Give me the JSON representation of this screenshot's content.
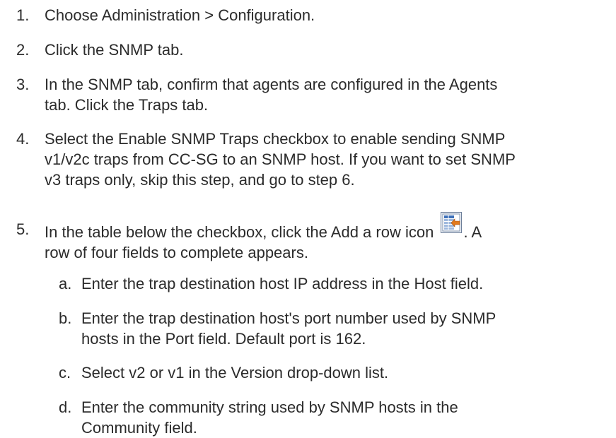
{
  "steps": [
    {
      "num": "1.",
      "text": "Choose Administration > Configuration."
    },
    {
      "num": "2.",
      "text": "Click the SNMP tab."
    },
    {
      "num": "3.",
      "line1": "In the SNMP tab, confirm that agents are configured in the Agents",
      "line2": "tab. Click the Traps tab."
    },
    {
      "num": "4.",
      "line1": "Select the Enable SNMP Traps checkbox to enable sending SNMP",
      "line2": "v1/v2c traps from CC-SG to an SNMP host. If you want to set SNMP",
      "line3": "v3 traps only, skip this step, and go to step 6."
    },
    {
      "num": "5.",
      "line1_before": "In the table below the checkbox, click the Add a row icon",
      "line1_after": ". A",
      "line2": "row of four fields to complete appears.",
      "icon": "add-row-icon"
    }
  ],
  "substeps": [
    {
      "num": "a.",
      "line1": "Enter the trap destination host IP address in the Host field."
    },
    {
      "num": "b.",
      "line1": "Enter the trap destination host's port number used by SNMP",
      "line2": "hosts in the Port field. Default port is 162."
    },
    {
      "num": "c.",
      "line1": "Select v2 or v1 in the Version drop-down list."
    },
    {
      "num": "d.",
      "line1": "Enter the community string used by SNMP hosts in the",
      "line2": "Community field."
    }
  ]
}
